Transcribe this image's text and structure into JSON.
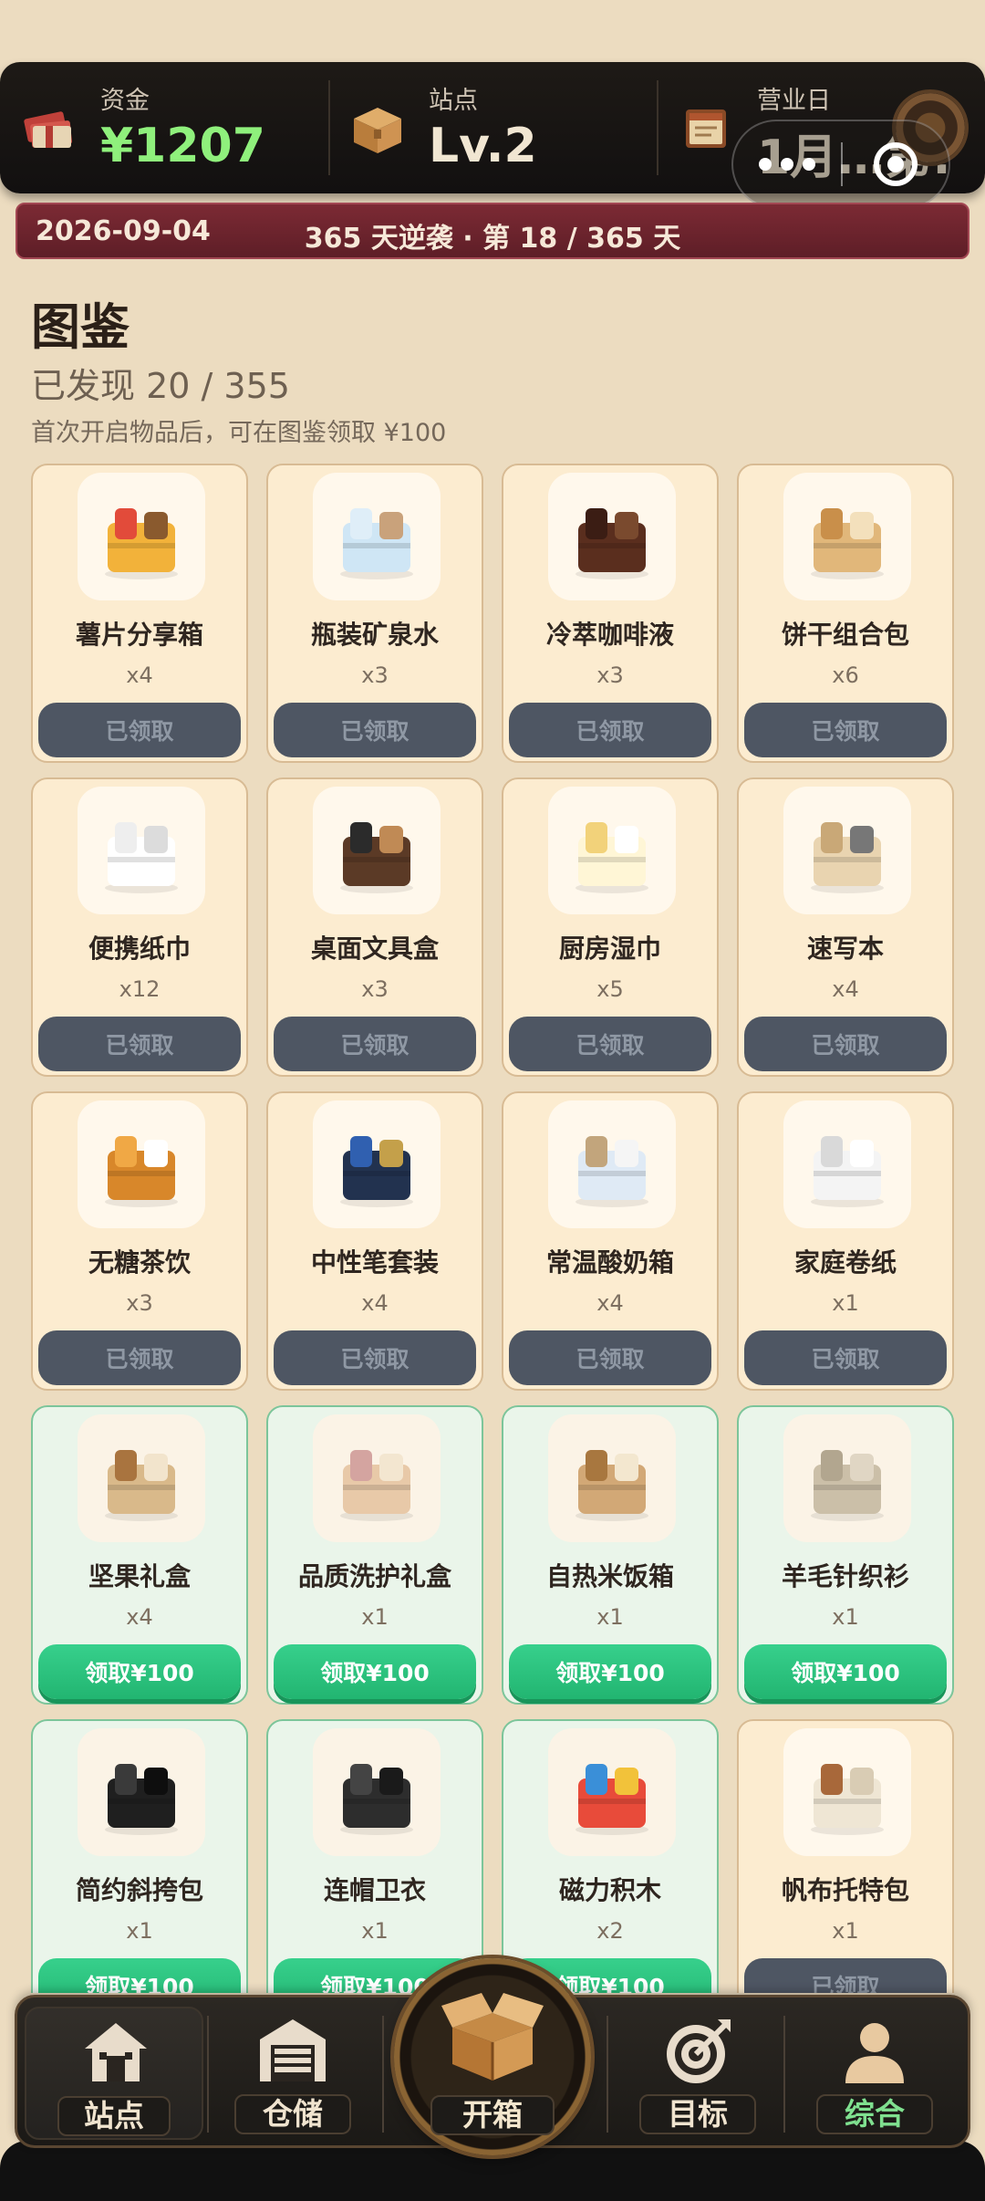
{
  "hud": {
    "funds": {
      "label": "资金",
      "value": "¥1207",
      "icon": "cash-stack-icon"
    },
    "station": {
      "label": "站点",
      "value": "Lv.2",
      "icon": "cardboard-box-icon"
    },
    "business_day": {
      "label": "营业日",
      "value": "1月…第:",
      "icon": "calendar-book-icon"
    }
  },
  "banner": {
    "date": "2026-09-04",
    "goal": "365 天逆袭 · 第 18 / 365 天"
  },
  "page": {
    "title": "图鉴",
    "found": "已发现 20 / 355",
    "hint": "首次开启物品后，可在图鉴领取 ¥100"
  },
  "items": [
    {
      "name": "薯片分享箱",
      "qty": "x4",
      "button": "已领取",
      "claimed": true,
      "icon": "chips-box-icon"
    },
    {
      "name": "瓶装矿泉水",
      "qty": "x3",
      "button": "已领取",
      "claimed": true,
      "icon": "water-bottles-icon"
    },
    {
      "name": "冷萃咖啡液",
      "qty": "x3",
      "button": "已领取",
      "claimed": true,
      "icon": "coffee-bottle-icon"
    },
    {
      "name": "饼干组合包",
      "qty": "x6",
      "button": "已领取",
      "claimed": true,
      "icon": "cookies-icon"
    },
    {
      "name": "便携纸巾",
      "qty": "x12",
      "button": "已领取",
      "claimed": true,
      "icon": "tissue-packs-icon"
    },
    {
      "name": "桌面文具盒",
      "qty": "x3",
      "button": "已领取",
      "claimed": true,
      "icon": "stationery-holder-icon"
    },
    {
      "name": "厨房湿巾",
      "qty": "x5",
      "button": "已领取",
      "claimed": true,
      "icon": "wet-wipes-icon"
    },
    {
      "name": "速写本",
      "qty": "x4",
      "button": "已领取",
      "claimed": true,
      "icon": "sketchbook-icon"
    },
    {
      "name": "无糖茶饮",
      "qty": "x3",
      "button": "已领取",
      "claimed": true,
      "icon": "tea-bottles-icon"
    },
    {
      "name": "中性笔套装",
      "qty": "x4",
      "button": "已领取",
      "claimed": true,
      "icon": "pen-set-icon"
    },
    {
      "name": "常温酸奶箱",
      "qty": "x4",
      "button": "已领取",
      "claimed": true,
      "icon": "yogurt-box-icon"
    },
    {
      "name": "家庭卷纸",
      "qty": "x1",
      "button": "已领取",
      "claimed": true,
      "icon": "toilet-rolls-icon"
    },
    {
      "name": "坚果礼盒",
      "qty": "x4",
      "button": "领取¥100",
      "claimed": false,
      "icon": "nut-gift-box-icon"
    },
    {
      "name": "品质洗护礼盒",
      "qty": "x1",
      "button": "领取¥100",
      "claimed": false,
      "icon": "toiletries-gift-icon"
    },
    {
      "name": "自热米饭箱",
      "qty": "x1",
      "button": "领取¥100",
      "claimed": false,
      "icon": "rice-boxes-icon"
    },
    {
      "name": "羊毛针织衫",
      "qty": "x1",
      "button": "领取¥100",
      "claimed": false,
      "icon": "sweater-icon"
    },
    {
      "name": "简约斜挎包",
      "qty": "x1",
      "button": "领取¥100",
      "claimed": false,
      "icon": "crossbody-bag-icon"
    },
    {
      "name": "连帽卫衣",
      "qty": "x1",
      "button": "领取¥100",
      "claimed": false,
      "icon": "hoodie-icon"
    },
    {
      "name": "磁力积木",
      "qty": "x2",
      "button": "领取¥100",
      "claimed": false,
      "icon": "magnetic-blocks-icon"
    },
    {
      "name": "帆布托特包",
      "qty": "x1",
      "button": "已领取",
      "claimed": true,
      "icon": "tote-bag-icon"
    }
  ],
  "nav": {
    "station": {
      "label": "站点",
      "icon": "house-icon"
    },
    "warehouse": {
      "label": "仓储",
      "icon": "warehouse-icon"
    },
    "open_box": {
      "label": "开箱",
      "icon": "open-box-icon"
    },
    "goals": {
      "label": "目标",
      "icon": "target-icon"
    },
    "overview": {
      "label": "综合",
      "icon": "person-icon"
    }
  },
  "colors": {
    "background": "#ecdcc0",
    "money": "#8ff07c",
    "claim_green": "#22b571",
    "claimed_gray": "#4e5663",
    "banner_red": "#7c2a34"
  }
}
